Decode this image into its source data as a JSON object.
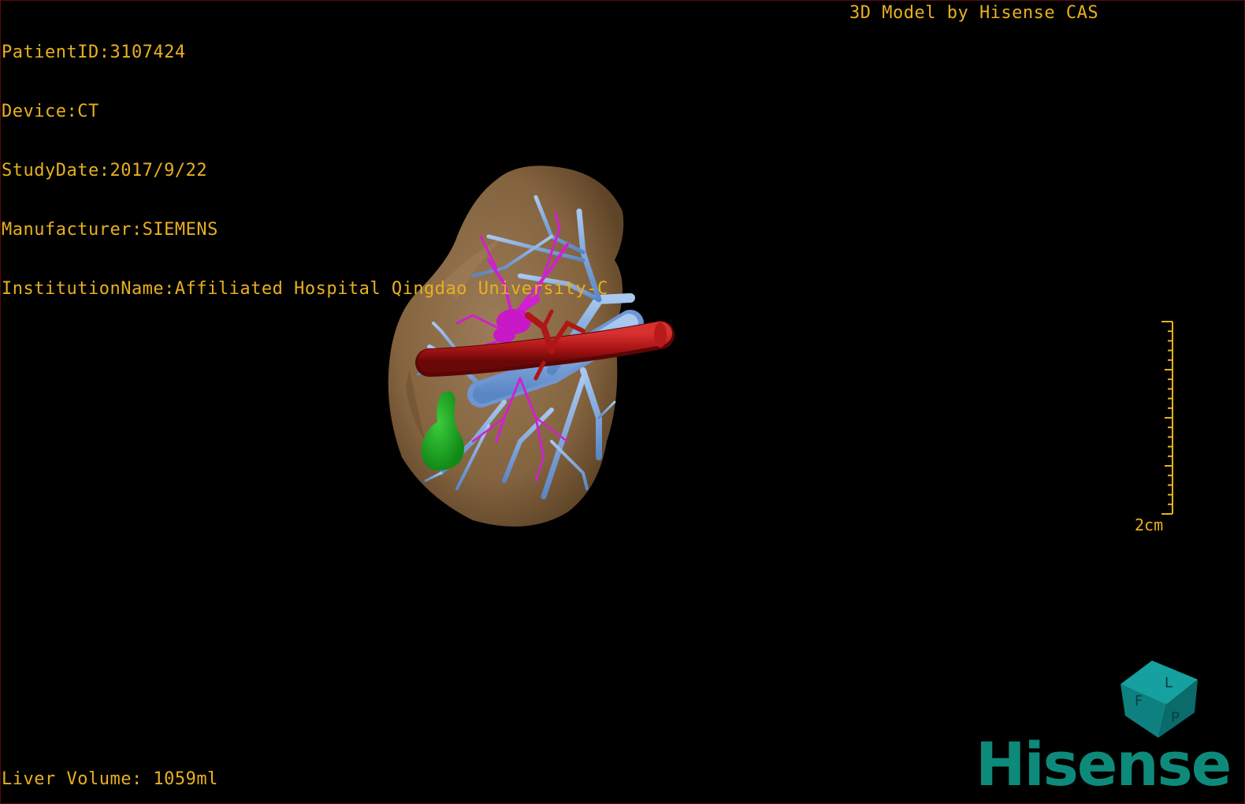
{
  "overlay": {
    "patient_id": "PatientID:3107424",
    "device": "Device:CT",
    "study_date": "StudyDate:2017/9/22",
    "manufacturer": "Manufacturer:SIEMENS",
    "institution": "InstitutionName:Affiliated Hospital Qingdao University-C",
    "brand": "3D Model by Hisense CAS",
    "liver_volume": "Liver Volume: 1059ml"
  },
  "scale_bar": {
    "label": "2cm"
  },
  "orientation_cube": {
    "faces": [
      "F",
      "L",
      "P"
    ]
  },
  "logo": {
    "text": "Hisense"
  },
  "colors": {
    "overlay_text": "#e8b020",
    "liver": "#8a6a48",
    "portal_vein": "#7fa7df",
    "hepatic_artery": "#c01818",
    "bile_duct": "#d020d0",
    "gallbladder": "#22a82a",
    "cube": "#0e8a8a",
    "logo": "#0e8a7a"
  }
}
